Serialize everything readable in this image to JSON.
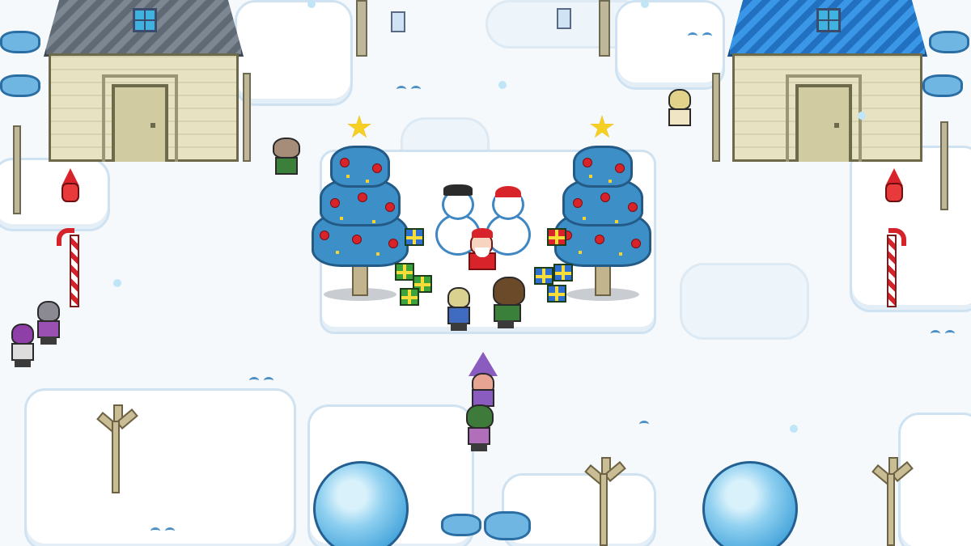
{
  "scene": {
    "title": "",
    "palette": {
      "snow": "#f6f9fc",
      "drift_edge": "#cfe2f1",
      "tree_blue": "#3d8fc8",
      "ornament_red": "#d8232a",
      "star_yellow": "#f6cf24",
      "house_wall": "#e7e2c2",
      "roof_grey": "#6d7782",
      "roof_blue": "#2a86d8"
    },
    "objects": {
      "houses": [
        "left-house",
        "right-house"
      ],
      "christmas_trees": [
        "left-christmas-tree",
        "right-christmas-tree"
      ],
      "snowmen": [
        "top-hat-snowman",
        "santa-hat-snowman"
      ],
      "characters": [
        "santa",
        "blonde-child",
        "brown-haired-villager",
        "purple-wizard",
        "green-haired-villager",
        "grey-villager",
        "purple-haired-villager",
        "mushroom-cap-villager",
        "blonde-villager"
      ],
      "icons": [
        "star-icon",
        "gift-icon",
        "candy-cane-icon",
        "snowball-icon",
        "bare-tree-icon",
        "gnome-icon",
        "bird-icon"
      ]
    }
  }
}
